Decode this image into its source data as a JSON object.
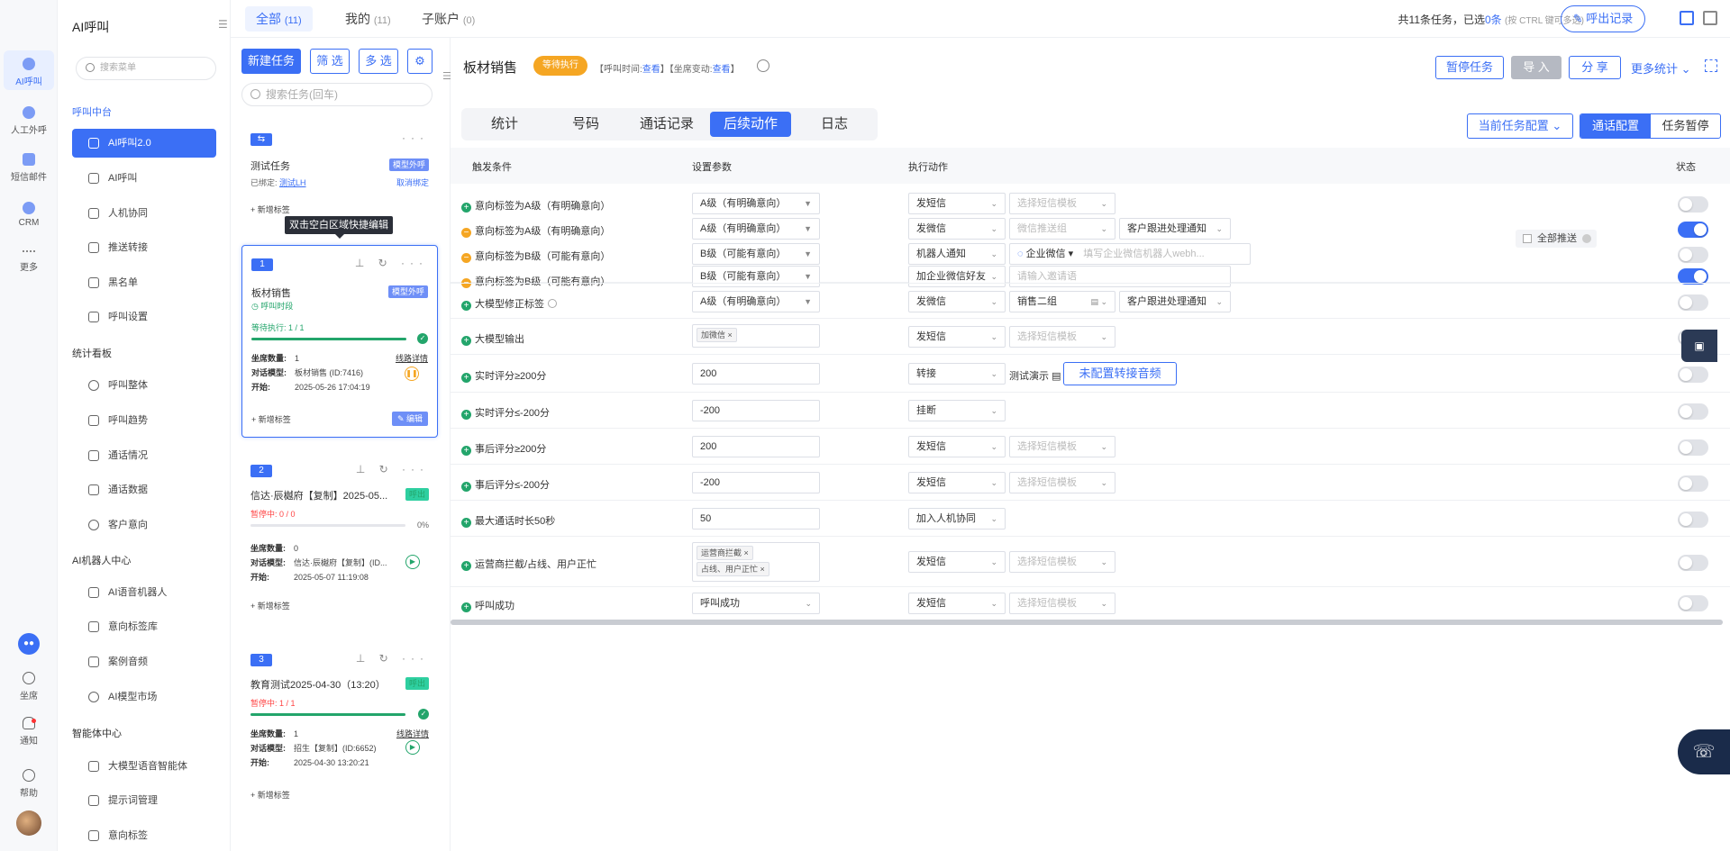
{
  "rail": {
    "items": [
      {
        "label": "AI呼叫",
        "icon": "ai-call-icon",
        "active": true
      },
      {
        "label": "人工外呼",
        "icon": "manual-call-icon"
      },
      {
        "label": "短信邮件",
        "icon": "sms-mail-icon"
      },
      {
        "label": "CRM",
        "icon": "crm-icon"
      },
      {
        "label": "更多",
        "icon": "more-icon"
      }
    ],
    "bottom": [
      {
        "label": "坐席",
        "icon": "headset-icon"
      },
      {
        "label": "通知",
        "icon": "bell-icon"
      },
      {
        "label": "帮助",
        "icon": "help-icon"
      }
    ]
  },
  "menu": {
    "title": "AI呼叫",
    "search_placeholder": "搜索菜单",
    "groups": [
      {
        "label": "呼叫中台"
      },
      {
        "label": "统计看板"
      },
      {
        "label": "AI机器人中心"
      },
      {
        "label": "智能体中心"
      }
    ],
    "items": [
      {
        "label": "AI呼叫2.0",
        "icon": "phone-icon",
        "active": true
      },
      {
        "label": "AI呼叫",
        "icon": "phone-icon"
      },
      {
        "label": "人机协同",
        "icon": "collab-icon"
      },
      {
        "label": "推送转接",
        "icon": "send-icon"
      },
      {
        "label": "黑名单",
        "icon": "warning-icon"
      },
      {
        "label": "呼叫设置",
        "icon": "sliders-icon"
      },
      {
        "label": "呼叫整体",
        "icon": "pie-icon"
      },
      {
        "label": "呼叫趋势",
        "icon": "bar-chart-icon"
      },
      {
        "label": "通话情况",
        "icon": "document-icon"
      },
      {
        "label": "通话数据",
        "icon": "data-icon"
      },
      {
        "label": "客户意向",
        "icon": "smile-icon"
      },
      {
        "label": "AI语音机器人",
        "icon": "robot-icon"
      },
      {
        "label": "意向标签库",
        "icon": "tag-icon"
      },
      {
        "label": "案例音频",
        "icon": "audio-icon"
      },
      {
        "label": "AI模型市场",
        "icon": "market-icon"
      },
      {
        "label": "大模型语音智能体",
        "icon": "agent-icon"
      },
      {
        "label": "提示词管理",
        "icon": "prompt-icon"
      },
      {
        "label": "意向标签",
        "icon": "tag-icon"
      }
    ]
  },
  "topbar": {
    "tabs": [
      {
        "label": "全部",
        "count": "(11)",
        "active": true
      },
      {
        "label": "我的",
        "count": "(11)"
      },
      {
        "label": "子账户",
        "count": "(0)"
      }
    ],
    "summary_prefix": "共11条任务，已选",
    "summary_selected": "0条",
    "summary_hint": "(按 CTRL 键可多选)",
    "call_record_label": "呼出记录"
  },
  "tasklist": {
    "new_task": "新建任务",
    "filter": "筛 选",
    "multi": "多 选",
    "search_placeholder": "搜索任务(回车)",
    "tooltip": "双击空白区域快捷编辑",
    "cards": [
      {
        "num": "MM",
        "title": "测试任务",
        "badge": "模型外呼",
        "bound_label": "已绑定:",
        "bound_user": "测试LH",
        "unbind": "取消绑定",
        "add_tag": "+ 新增标签"
      },
      {
        "num": "1",
        "title": "板材销售",
        "badge": "模型外呼",
        "status": "呼叫时段",
        "progress_label": "等待执行: 1 / 1",
        "progress": 1.0,
        "seats_label": "坐席数量:",
        "seats": "1",
        "line_detail": "线路详情",
        "model_label": "对话模型:",
        "model": "板材销售 (ID:7416)",
        "start_label": "开始:",
        "start": "2025-05-26 17:04:19",
        "add_tag": "+ 新增标签",
        "edit": "编辑"
      },
      {
        "num": "2",
        "title": "信达·辰樾府【复制】2025-05...",
        "badge": "呼出",
        "progress_label": "暂停中: 0 / 0",
        "progress": 0.0,
        "pct": "0%",
        "seats_label": "坐席数量:",
        "seats": "0",
        "model_label": "对话模型:",
        "model": "信达·辰樾府【复制】(ID...",
        "start_label": "开始:",
        "start": "2025-05-07 11:19:08",
        "add_tag": "+ 新增标签"
      },
      {
        "num": "3",
        "title": "教育测试2025-04-30（13:20）",
        "badge": "呼出",
        "progress_label": "暂停中: 1 / 1",
        "progress": 1.0,
        "seats_label": "坐席数量:",
        "seats": "1",
        "line_detail": "线路详情",
        "model_label": "对话模型:",
        "model": "招生【复制】(ID:6652)",
        "start_label": "开始:",
        "start": "2025-04-30 13:20:21",
        "add_tag": "+ 新增标签"
      }
    ]
  },
  "main": {
    "title": "板材销售",
    "status": "等待执行",
    "meta_call_time": "【呼叫时间:",
    "meta_view1": "查看",
    "meta_seat_change": "】【坐席变动:",
    "meta_view2": "查看",
    "meta_end": "】",
    "buttons": {
      "pause": "暂停任务",
      "import": "导 入",
      "share": "分 享",
      "more_stats": "更多统计"
    },
    "tabs": [
      {
        "label": "统计"
      },
      {
        "label": "号码"
      },
      {
        "label": "通话记录"
      },
      {
        "label": "后续动作",
        "active": true
      },
      {
        "label": "日志"
      }
    ],
    "config_select": "当前任务配置",
    "right_tabs": [
      {
        "label": "通话配置",
        "active": true
      },
      {
        "label": "任务暂停"
      }
    ],
    "columns": {
      "trigger": "触发条件",
      "params": "设置参数",
      "action": "执行动作",
      "state": "状态"
    },
    "push_all": "全部推送",
    "rows": [
      {
        "cond": "意向标签为A级（有明确意向）",
        "icon": "plus",
        "param": "A级（有明确意向）",
        "action": "发短信",
        "extra1": "选择短信模板",
        "extra1_ph": true,
        "on": false
      },
      {
        "cond": "意向标签为A级（有明确意向）",
        "icon": "minus",
        "param": "A级（有明确意向）",
        "action": "发微信",
        "extra1": "微信推送组",
        "extra1_ph": true,
        "extra2": "客户跟进处理通知",
        "on": true
      },
      {
        "cond": "意向标签为B级（可能有意向）",
        "icon": "minus",
        "param": "B级（可能有意向）",
        "action": "机器人通知",
        "extra1": "企业微信",
        "extra_input": "填写企业微信机器人webh...",
        "on": false
      },
      {
        "cond": "意向标签为B级（可能有意向）",
        "icon": "minus",
        "param": "B级（可能有意向）",
        "action": "加企业微信好友",
        "extra_input": "请输入邀请语",
        "on": true
      },
      {
        "cond": "大模型修正标签",
        "icon": "plus",
        "help": true,
        "param": "A级（有明确意向）",
        "action": "发微信",
        "extra1": "销售二组",
        "extra2": "客户跟进处理通知",
        "on": false
      },
      {
        "cond": "大模型输出",
        "icon": "plus",
        "chips": [
          "加微信"
        ],
        "action": "发短信",
        "extra1": "选择短信模板",
        "extra1_ph": true,
        "on": false
      },
      {
        "cond": "实时评分≥200分",
        "icon": "plus",
        "input": "200",
        "action": "转接",
        "demo": "测试演示",
        "transfer_btn": "未配置转接音频",
        "on": false
      },
      {
        "cond": "实时评分≤-200分",
        "icon": "plus",
        "input": "-200",
        "action": "挂断",
        "on": false
      },
      {
        "cond": "事后评分≥200分",
        "icon": "plus",
        "input": "200",
        "action": "发短信",
        "extra1": "选择短信模板",
        "extra1_ph": true,
        "on": false
      },
      {
        "cond": "事后评分≤-200分",
        "icon": "plus",
        "input": "-200",
        "action": "发短信",
        "extra1": "选择短信模板",
        "extra1_ph": true,
        "on": false
      },
      {
        "cond": "最大通话时长50秒",
        "icon": "plus",
        "input": "50",
        "action": "加入人机协同",
        "on": false
      },
      {
        "cond": "运营商拦截/占线、用户正忙",
        "icon": "plus",
        "chips": [
          "运营商拦截",
          "占线、用户正忙"
        ],
        "action": "发短信",
        "extra1": "选择短信模板",
        "extra1_ph": true,
        "on": false
      },
      {
        "cond": "呼叫成功",
        "icon": "plus",
        "param": "呼叫成功",
        "action": "发短信",
        "extra1": "选择短信模板",
        "extra1_ph": true,
        "on": false
      }
    ]
  }
}
